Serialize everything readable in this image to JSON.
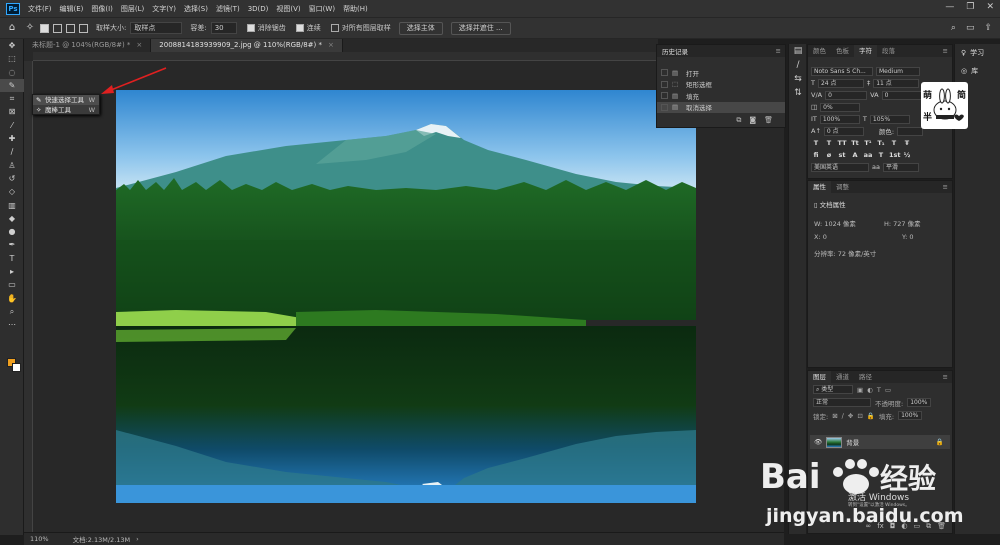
{
  "menubar": {
    "logo": "Ps",
    "items": [
      "文件(F)",
      "编辑(E)",
      "图像(I)",
      "图层(L)",
      "文字(Y)",
      "选择(S)",
      "滤镜(T)",
      "3D(D)",
      "视图(V)",
      "窗口(W)",
      "帮助(H)"
    ],
    "controls": [
      "—",
      "❐",
      "✕"
    ]
  },
  "options": {
    "sample_size_label": "取样大小:",
    "sample_size_value": "取样点",
    "tolerance_label": "容差:",
    "tolerance_value": "30",
    "antialias_label": "消除锯齿",
    "contiguous_label": "连续",
    "sample_all_label": "对所有图层取样",
    "select_subject": "选择主体",
    "select_mask": "选择并遮住 ..."
  },
  "tabs": [
    {
      "label": "未标题-1 @ 104%(RGB/8#) *",
      "active": false
    },
    {
      "label": "2008814183939909_2.jpg @ 110%(RGB/8#) *",
      "active": true
    }
  ],
  "flyout": {
    "items": [
      {
        "label": "快速选择工具",
        "key": "W"
      },
      {
        "label": "魔棒工具",
        "key": "W"
      }
    ]
  },
  "history": {
    "title": "历史记录",
    "items": [
      {
        "icon": "▤",
        "label": "打开"
      },
      {
        "icon": "⬚",
        "label": "矩形选框"
      },
      {
        "icon": "▤",
        "label": "填充"
      },
      {
        "icon": "▤",
        "label": "取消选择"
      }
    ],
    "selected_index": 3
  },
  "character": {
    "tabs": [
      "颜色",
      "色板",
      "字符",
      "段落"
    ],
    "active_tab": "字符",
    "font_family": "Noto Sans S Ch...",
    "font_style": "Medium",
    "font_size": "24 点",
    "leading": "11 点",
    "kerning": "0",
    "tracking": "0",
    "scale_pct": "0%",
    "vert_scale": "100%",
    "horiz_scale": "105%",
    "baseline": "0 点",
    "color_label": "颜色:",
    "language": "美国英语",
    "aa": "aa",
    "aa_mode": "平滑"
  },
  "properties": {
    "tabs": [
      "属性",
      "调整"
    ],
    "section": "文档属性",
    "w_label": "W:",
    "w_value": "1024 像素",
    "h_label": "H:",
    "h_value": "727 像素",
    "x_label": "X:",
    "x_value": "0",
    "y_label": "Y:",
    "y_value": "0",
    "resolution": "分辨率: 72 像素/英寸"
  },
  "layers": {
    "tabs": [
      "图层",
      "通道",
      "路径"
    ],
    "kind": "类型",
    "blend": "正常",
    "opacity_label": "不透明度:",
    "opacity": "100%",
    "lock_label": "锁定:",
    "fill_label": "填充:",
    "fill": "100%",
    "layer_name": "背景"
  },
  "strip2": {
    "learn": "学习",
    "library": "库"
  },
  "status": {
    "zoom": "110%",
    "doc": "文档:2.13M/2.13M"
  },
  "sticker": {
    "chars": [
      "萌",
      "半",
      "简"
    ]
  },
  "watermark": {
    "brand": "Bai",
    "brand2": "经验",
    "url": "jingyan.baidu.com",
    "activate": "激活 Windows",
    "activate_sub": "转到\"设置\"以激活 Windows。"
  }
}
